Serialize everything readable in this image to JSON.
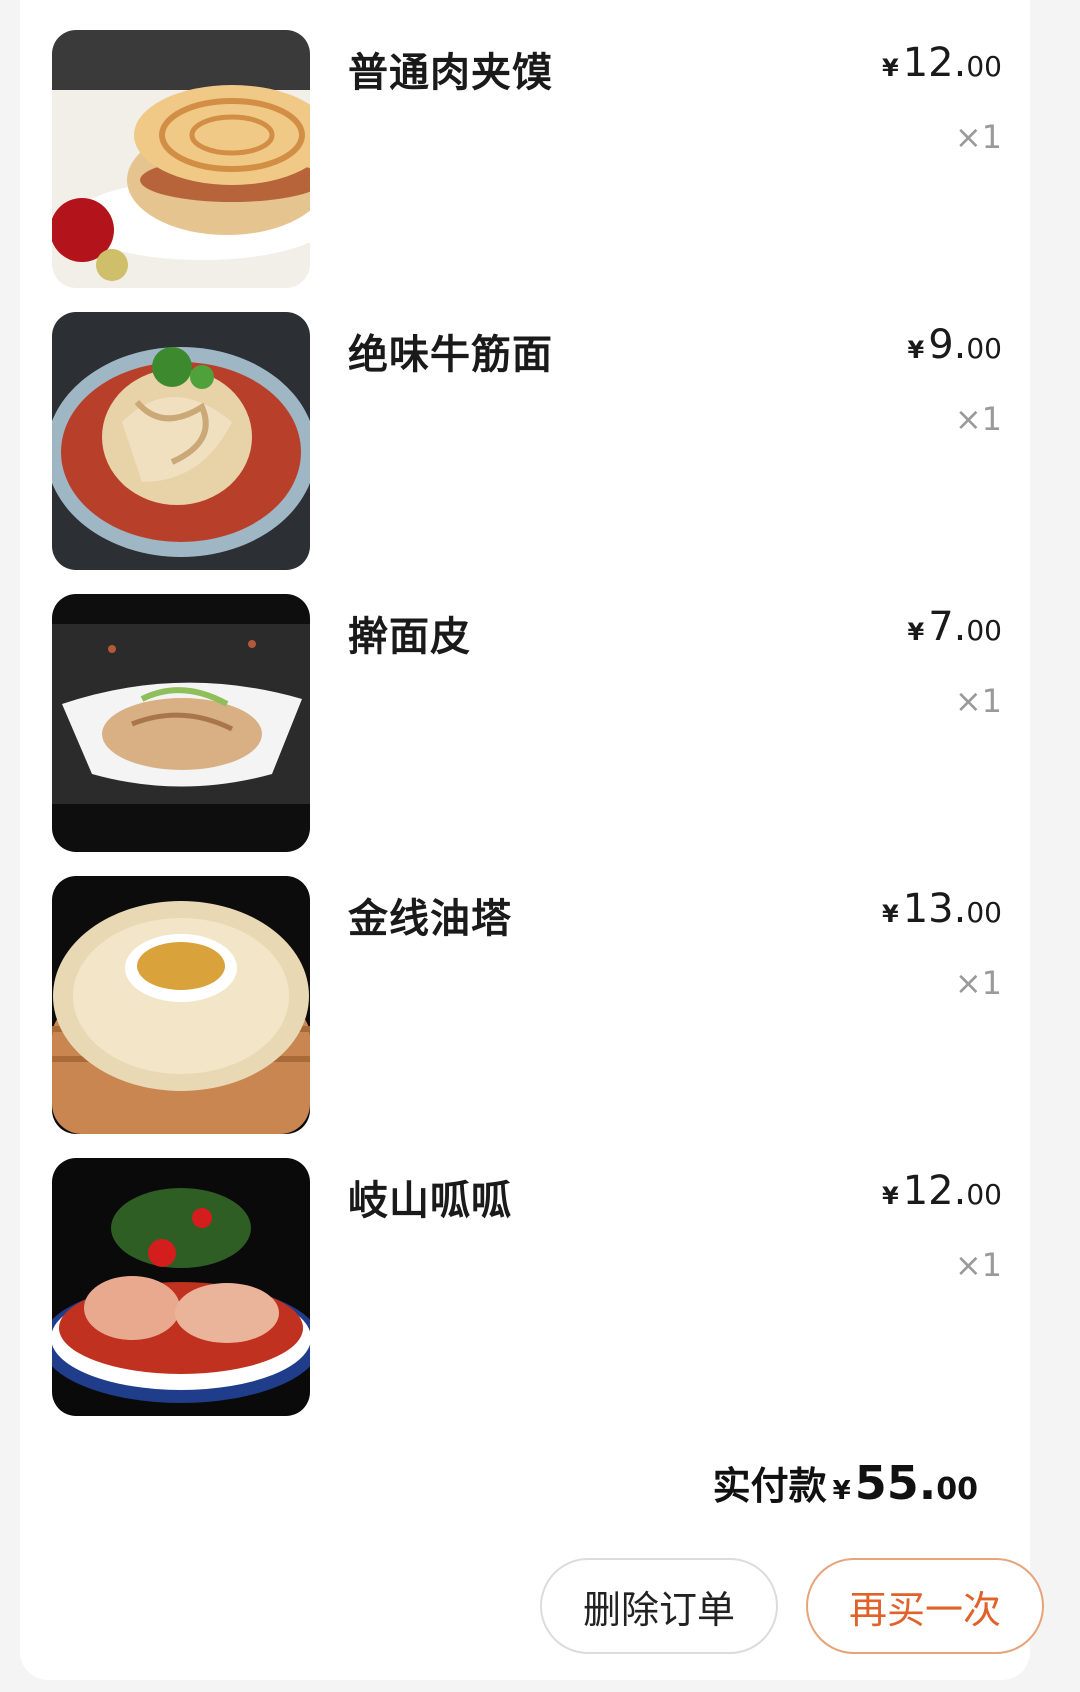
{
  "order": {
    "items": [
      {
        "name": "普通肉夹馍",
        "price_yen": "¥",
        "price_int": "12.",
        "price_dec": "00",
        "qty": "×1"
      },
      {
        "name": "绝味牛筋面",
        "price_yen": "¥",
        "price_int": "9.",
        "price_dec": "00",
        "qty": "×1"
      },
      {
        "name": "擀面皮",
        "price_yen": "¥",
        "price_int": "7.",
        "price_dec": "00",
        "qty": "×1"
      },
      {
        "name": "金线油塔",
        "price_yen": "¥",
        "price_int": "13.",
        "price_dec": "00",
        "qty": "×1"
      },
      {
        "name": "岐山呱呱",
        "price_yen": "¥",
        "price_int": "12.",
        "price_dec": "00",
        "qty": "×1"
      }
    ],
    "total": {
      "label": "实付款",
      "yen": "¥",
      "int": "55.",
      "dec": "00"
    },
    "actions": {
      "delete_label": "删除订单",
      "rebuy_label": "再买一次"
    }
  },
  "colors": {
    "accent": "#e0622b",
    "accent_border": "#e7a37a",
    "muted_text": "#9a9a9a"
  }
}
